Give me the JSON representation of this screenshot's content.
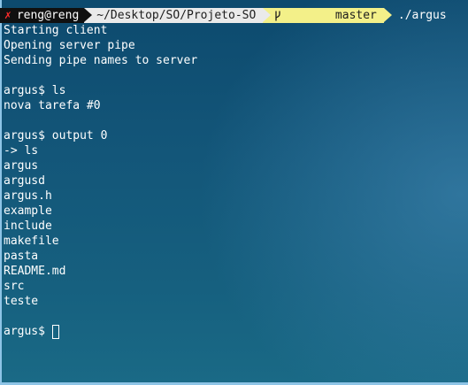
{
  "prompt": {
    "status_icon": "x-mark",
    "user_host": "reng@reng",
    "path": "~/Desktop/SO/Projeto-SO",
    "branch_icon": "git-branch-icon",
    "branch": "master",
    "command": "./argus"
  },
  "colors": {
    "background": "#135679",
    "segment_user": "#101010",
    "segment_path": "#eaeaea",
    "segment_branch": "#f3f089",
    "error_mark": "#ff2a2a"
  },
  "output_lines": [
    "Starting client",
    "Opening server pipe",
    "Sending pipe names to server",
    "",
    "argus$ ls",
    "nova tarefa #0",
    "",
    "argus$ output 0",
    "-> ls",
    "argus",
    "argusd",
    "argus.h",
    "example",
    "include",
    "makefile",
    "pasta",
    "README.md",
    "src",
    "teste",
    ""
  ],
  "current_prompt": "argus$"
}
